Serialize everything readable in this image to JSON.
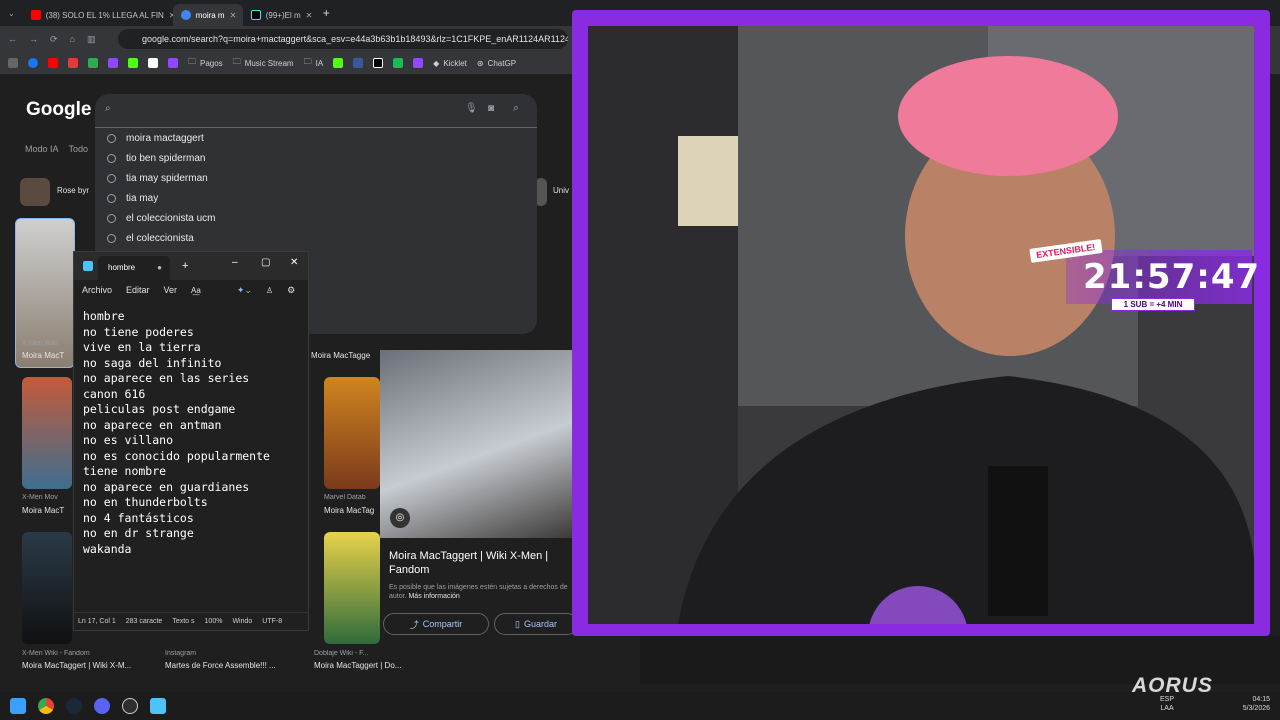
{
  "browser": {
    "tabs": [
      {
        "label": "(38) SOLO EL 1% LLEGA AL FIN",
        "color": "#ff0000",
        "active": false
      },
      {
        "label": "moira m",
        "color": "#4285f4",
        "active": true
      },
      {
        "label": "(99+)El m",
        "color": "#000000",
        "active": false
      }
    ],
    "url": "google.com/search?q=moira+mactaggert&sca_esv=e44a3b63b1b18493&rlz=1C1FKPE_enAR1124AR1124&udr",
    "bookmarks": [
      {
        "label": "Pagos",
        "icon": "folder-icon"
      },
      {
        "label": "Music Stream",
        "icon": "folder-icon"
      },
      {
        "label": "IA",
        "icon": "folder-icon"
      },
      {
        "label": "Kicklet",
        "icon": "kicklet-icon"
      },
      {
        "label": "ChatGP",
        "icon": "chatgpt-icon"
      }
    ]
  },
  "google": {
    "logo": "Google",
    "suggestions": [
      "moira mactaggert",
      "tio ben spiderman",
      "tia may spiderman",
      "tia may",
      "el coleccionista ucm",
      "el coleccionista"
    ],
    "filters": {
      "mode_ia": "Modo IA",
      "all": "Todo"
    },
    "chip_left": "Rose byr",
    "chip_right": "Univ",
    "results": [
      {
        "source": "X-Men Wiki",
        "caption": "Moira MacT"
      },
      {
        "source": "",
        "caption": "Moira MacTagge"
      },
      {
        "source": "X-Men Mov",
        "caption": "Moira MacT"
      },
      {
        "source": "Marvel Datab",
        "caption": "Moira MacTag"
      },
      {
        "source": "X-Men Wiki - Fandom",
        "caption": "Moira MacTaggert | Wiki X-M..."
      },
      {
        "source": "Instagram",
        "caption": "Martes de Force Assemble!!! ..."
      },
      {
        "source": "Doblaje Wiki - F...",
        "caption": "Moira MacTaggert | Do..."
      }
    ],
    "preview": {
      "title": "Moira MacTaggert | Wiki X-Men | Fandom",
      "note": "Es posible que las imágenes estén sujetas a derechos de autor.",
      "more_info": "Más información",
      "share": "Compartir",
      "save": "Guardar"
    }
  },
  "notepad": {
    "tab_title": "hombre",
    "menu": [
      "Archivo",
      "Editar",
      "Ver"
    ],
    "lines": [
      "hombre",
      "no tiene poderes",
      "vive en la tierra",
      "no saga del infinito",
      "no aparece en las series",
      "canon 616",
      "peliculas post endgame",
      "no aparece en antman",
      "no es villano",
      "no es conocido popularmente",
      "tiene nombre",
      "no aparece en guardianes",
      "no en thunderbolts",
      "no 4 fantásticos",
      "no en dr strange",
      "wakanda"
    ],
    "status": {
      "position": "Ln 17, Col 1",
      "chars": "283 caracte",
      "format": "Texto s",
      "zoom": "100%",
      "eol": "Windo",
      "encoding": "UTF-8"
    }
  },
  "stream": {
    "timer": "21:57:47",
    "sub_rule": "1 SUB = +4 MIN",
    "extensible": "EXTENSIBLE!",
    "accent": "#8a2be2"
  },
  "system": {
    "language": "ESP",
    "layout": "LAA",
    "time": "04:15",
    "date": "5/3/2026",
    "brand": "AORUS"
  }
}
